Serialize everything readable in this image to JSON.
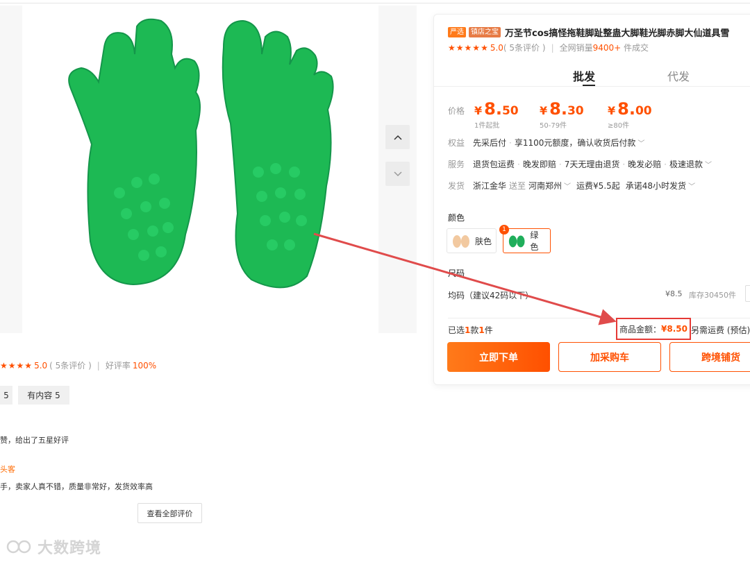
{
  "gallery": {
    "up_icon": "chevron-up-icon",
    "down_icon": "chevron-down-icon"
  },
  "product": {
    "badge_yanxuan": "严选",
    "badge_shop": "镇店之宝",
    "title": "万圣节cos搞怪拖鞋脚趾整蛊大脚鞋光脚赤脚大仙道具雪",
    "score": "5.0",
    "review_count_text": "( 5条评价 )",
    "sales_prefix": "全网销量",
    "sales_value": "9400+",
    "sales_suffix": " 件成交"
  },
  "tabs": {
    "pifa": "批发",
    "daifa": "代发"
  },
  "price": {
    "label": "价格",
    "tiers": [
      {
        "yen": "¥",
        "int": "8.",
        "dec": "50",
        "cond": "1件起批"
      },
      {
        "yen": "¥",
        "int": "8.",
        "dec": "30",
        "cond": "50-79件"
      },
      {
        "yen": "¥",
        "int": "8.",
        "dec": "00",
        "cond": "≥80件"
      }
    ]
  },
  "rights": {
    "label": "权益",
    "text1": "先采后付",
    "text2": "享1100元额度，确认收货后付款"
  },
  "service": {
    "label": "服务",
    "items": [
      "退货包运费",
      "晚发即赔",
      "7天无理由退货",
      "晚发必赔",
      "极速退款"
    ]
  },
  "shipping": {
    "label": "发货",
    "from": "浙江金华",
    "to_word": "送至",
    "dest": "河南郑州",
    "fee": "运费¥5.5起",
    "promise": "承诺48小时发货"
  },
  "color": {
    "title": "颜色",
    "options": [
      {
        "label": "肤色",
        "swatch": "#f2c9a0"
      },
      {
        "label": "绿色",
        "swatch": "#1fae5b",
        "badge": "1"
      }
    ]
  },
  "size": {
    "title": "尺码",
    "label": "均码（建议42码以下）",
    "price": "¥8.5",
    "stock": "库存30450件",
    "minus": "-"
  },
  "summary": {
    "selected_prefix": "已选",
    "selected_kinds": "1",
    "kinds_word": "款",
    "selected_qty": "1",
    "qty_word": "件",
    "goods_label": "商品金额：",
    "goods_value": "¥8.50",
    "extra": "另需运费 (预估):"
  },
  "buttons": {
    "buy": "立即下单",
    "cart": "加采购车",
    "cross": "跨境铺货"
  },
  "reviews": {
    "score": "5.0",
    "count_text": "( 5条评价 )",
    "good_rate_label": "好评率",
    "good_rate": "100%",
    "tag_a": "5",
    "tag_b": "有内容 5",
    "line1": "赞，给出了五星好评",
    "user": "头客",
    "line2": "手，卖家人真不错，质量非常好，发货效率高",
    "view_all": "查看全部评价"
  },
  "watermark": {
    "text": "大数跨境"
  },
  "colors": {
    "accent": "#ff5000",
    "highlight_box": "#e53935",
    "arrow": "#e04b4b"
  }
}
